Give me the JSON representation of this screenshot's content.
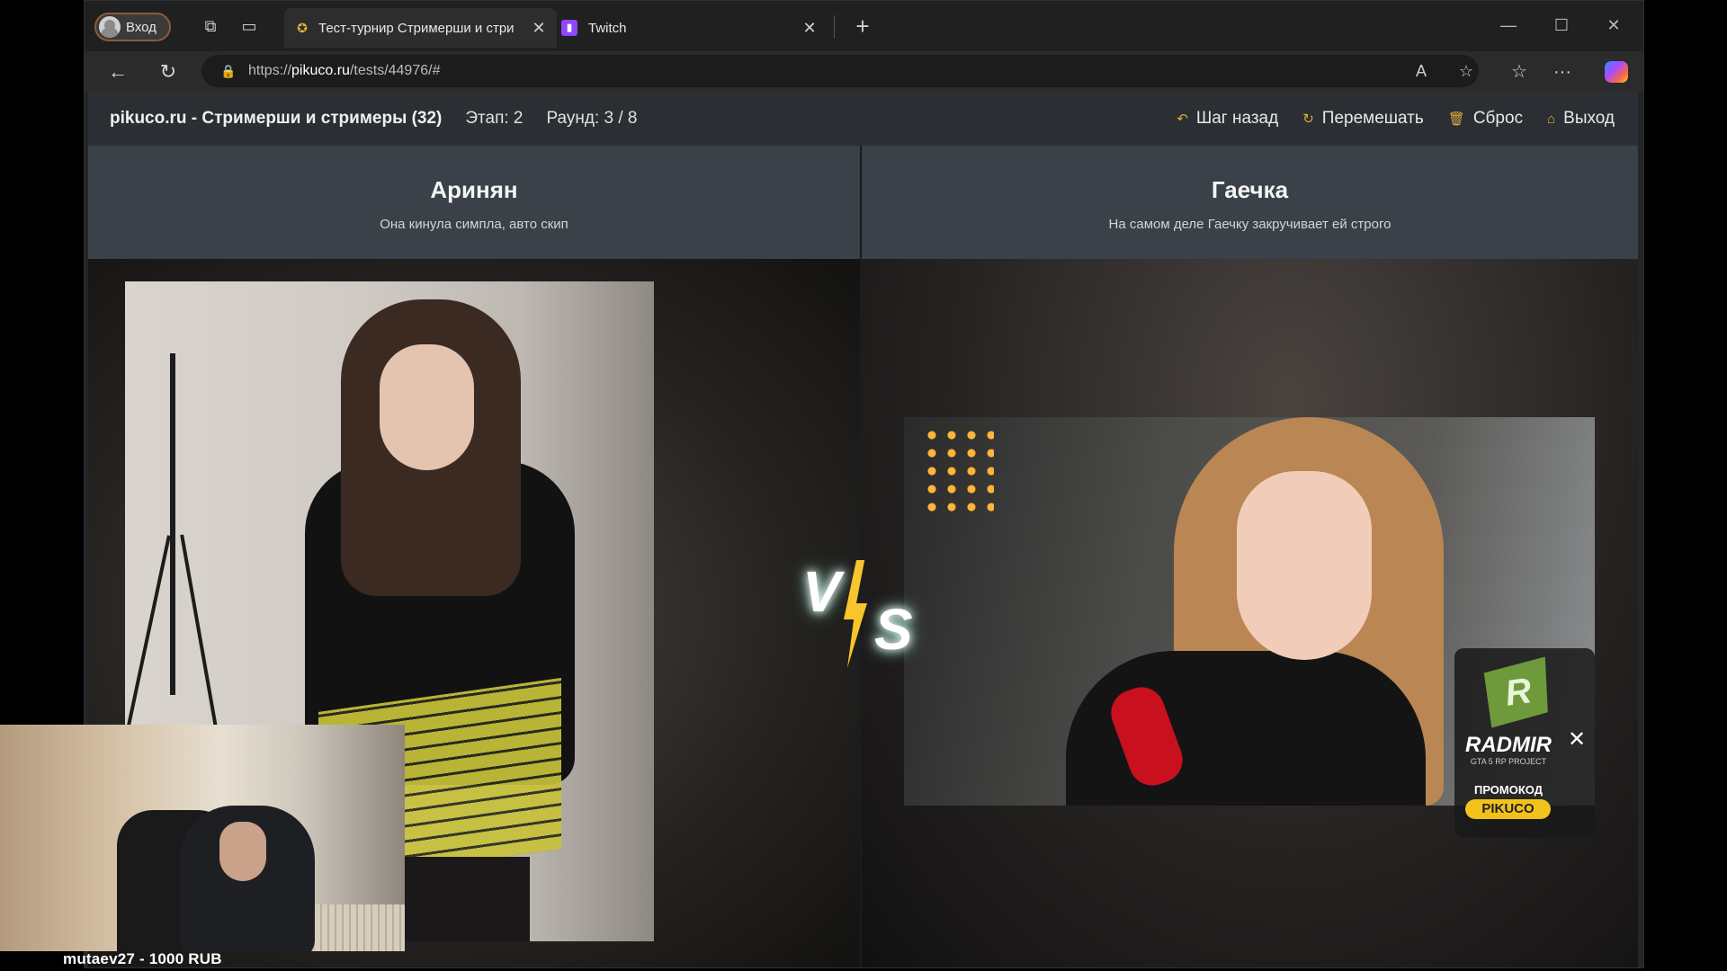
{
  "browser": {
    "profile_label": "Вход",
    "tabs": [
      {
        "title": "Тест-турнир Стримерши и стри",
        "icon": "pikuco-favicon"
      },
      {
        "title": "Twitch",
        "icon": "twitch-favicon"
      }
    ],
    "url_prefix": "https://",
    "url_host": "pikuco.ru",
    "url_path": "/tests/44976/#"
  },
  "site": {
    "title": "pikuco.ru - Стримерши и стримеры (32)",
    "stage": "Этап: 2",
    "round": "Раунд: 3 / 8",
    "actions": {
      "back": "Шаг назад",
      "shuffle": "Перемешать",
      "reset": "Сброс",
      "exit": "Выход"
    }
  },
  "contestants": {
    "left": {
      "name": "Аринян",
      "description": "Она кинула симпла, авто скип"
    },
    "right": {
      "name": "Гаечка",
      "description": "На самом деле Гаечку закручивает ей строго"
    }
  },
  "ad": {
    "brand": "RADMIR",
    "subtitle": "GTA 5 RP PROJECT",
    "promo_label": "ПРОМОКОД",
    "promo_code": "PIKUCO",
    "accent": "#f1c21b"
  },
  "stream": {
    "donation": "mutaev27 - 1000 RUB"
  },
  "colors": {
    "header_bg": "#2b2f33",
    "panel_bg": "#3a4148",
    "action_icon": "#e2a93a"
  }
}
